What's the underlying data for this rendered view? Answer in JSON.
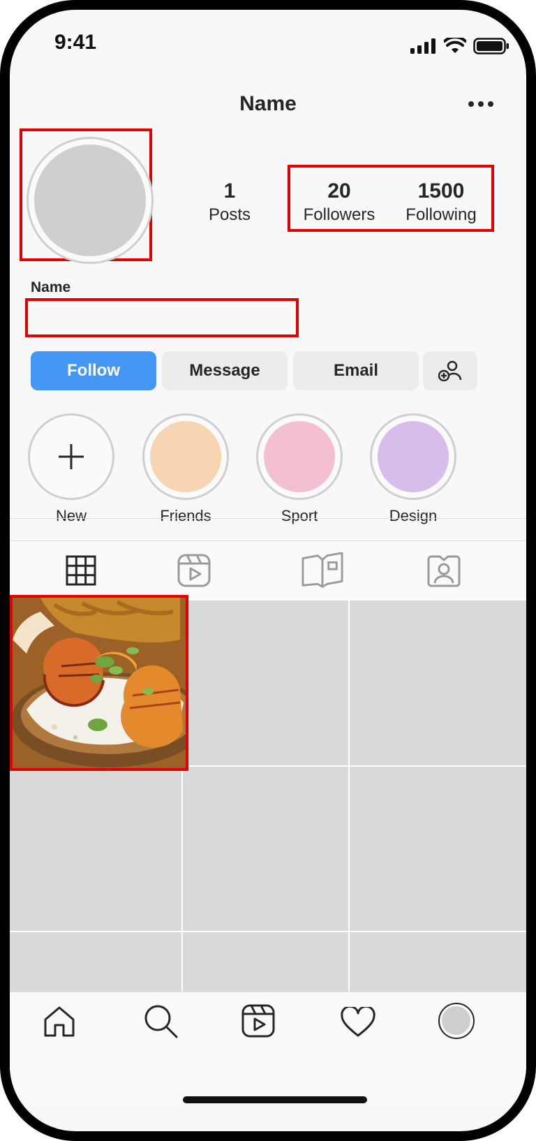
{
  "status": {
    "time": "9:41"
  },
  "header": {
    "title": "Name",
    "more_icon": "more-horizontal-icon"
  },
  "profile": {
    "stats": [
      {
        "num": "1",
        "label": "Posts"
      },
      {
        "num": "20",
        "label": "Followers"
      },
      {
        "num": "1500",
        "label": "Following"
      }
    ],
    "name_label": "Name",
    "name_value": ""
  },
  "actions": {
    "follow": "Follow",
    "message": "Message",
    "email": "Email",
    "add_icon": "add-user-icon"
  },
  "highlights": [
    {
      "label": "New",
      "color": ""
    },
    {
      "label": "Friends",
      "color": "#f8d5b2"
    },
    {
      "label": "Sport",
      "color": "#f3bfd2"
    },
    {
      "label": "Design",
      "color": "#d6bdeb"
    }
  ],
  "tabs": [
    "grid-icon",
    "reels-icon",
    "guide-icon",
    "tagged-icon"
  ],
  "bottom_nav": [
    "home-icon",
    "search-icon",
    "reels-icon",
    "heart-icon",
    "profile-avatar"
  ],
  "colors": {
    "accent": "#4597f5",
    "highlight_box": "#e30000"
  }
}
